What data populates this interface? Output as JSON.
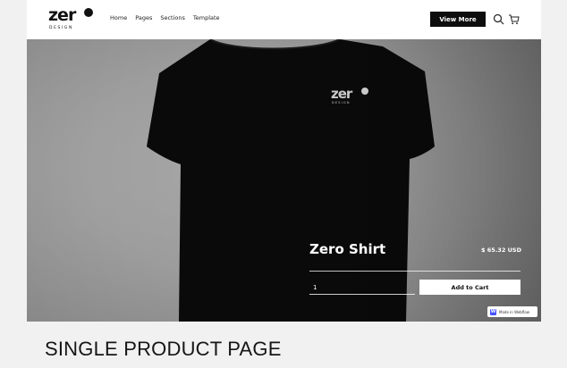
{
  "brand": {
    "logo_word": "zer",
    "logo_sub": "DESIGN"
  },
  "nav": {
    "links": [
      "Home",
      "Pages",
      "Sections",
      "Template"
    ],
    "cta_label": "View More",
    "icons": [
      "search-icon",
      "cart-icon"
    ]
  },
  "hero": {
    "shirt_logo_word": "zer",
    "shirt_logo_sub": "DESIGN",
    "product_title": "Zero Shirt",
    "price": "$ 65.32 USD",
    "quantity_value": "1",
    "add_to_cart_label": "Add to Cart",
    "webflow_badge": "Made in Webflow"
  },
  "caption": "SINGLE PRODUCT PAGE",
  "colors": {
    "page_bg": "#f1f1f1",
    "nav_cta_bg": "#0d0d0d",
    "shirt": "#0b0b0b",
    "badge_accent": "#4353ff"
  }
}
